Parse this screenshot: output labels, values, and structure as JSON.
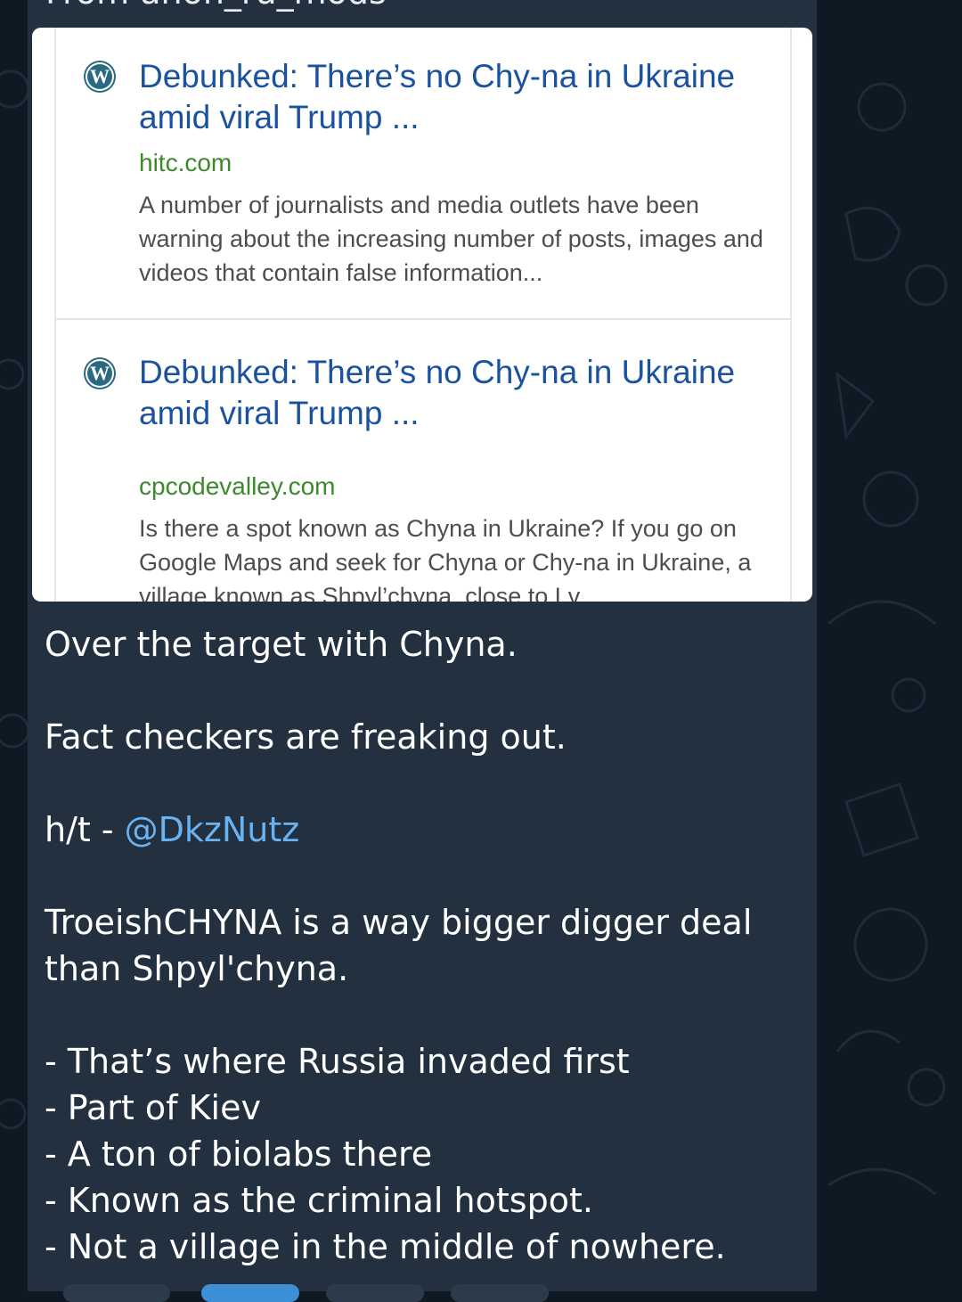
{
  "forward_header": "From anon_ru_mods",
  "search_results": [
    {
      "title": "Debunked: There’s no Chy-na in Ukraine amid viral Trump ...",
      "domain": "hitc.com",
      "snippet": "A number of journalists and media outlets have been warning about the increasing number of posts, images and videos that contain false information..."
    },
    {
      "title": "Debunked: There’s no Chy-na in Ukraine amid viral Trump ...",
      "domain": "cpcodevalley.com",
      "snippet": "Is there a spot known as Chyna in Ukraine? If you go on Google Maps and seek for Chyna or Chy-na in Ukraine, a village known as Shpyl’chyna, close to Lv..."
    }
  ],
  "site_icon": "wordpress-icon",
  "caption": {
    "line1": "Over the target with Chyna.",
    "line2": "Fact checkers are freaking out.",
    "ht_prefix": "h/t - ",
    "mention": "@DkzNutz",
    "paragraph": "TroeishCHYNA is a way bigger digger deal than Shpyl'chyna.",
    "bullets": [
      "- That’s where Russia invaded first",
      "- Part of Kiev",
      "- A ton of biolabs there",
      "- Known as the criminal hotspot.",
      "- Not a village in the middle of nowhere."
    ]
  },
  "colors": {
    "chat_background": "#0f1923",
    "bubble": "#22303f",
    "link": "#6ab3f3",
    "result_title": "#1a52a0",
    "result_domain": "#3d8a2e"
  }
}
